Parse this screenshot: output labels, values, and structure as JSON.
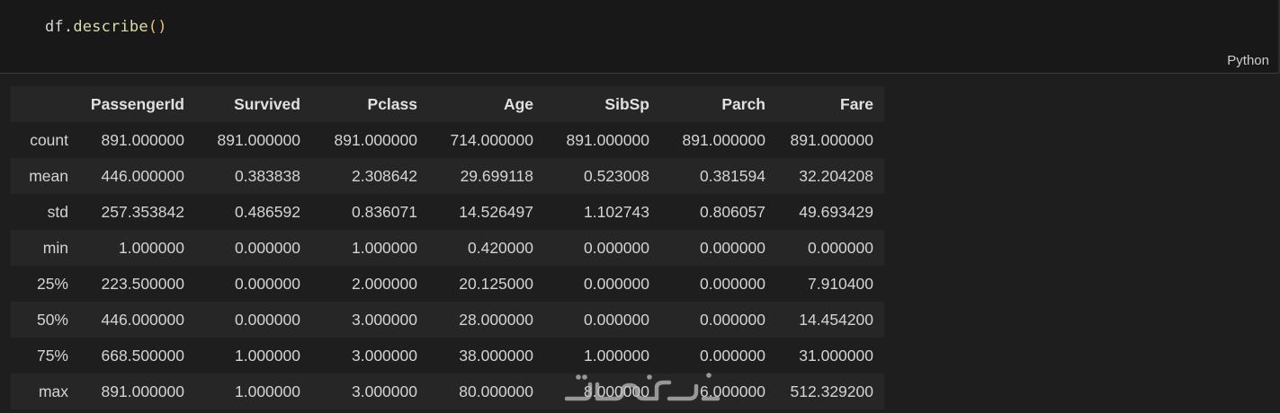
{
  "cell": {
    "code": {
      "object": "df",
      "dot": ".",
      "method": "describe",
      "parens": "()"
    },
    "language": "Python"
  },
  "table": {
    "columns": [
      "PassengerId",
      "Survived",
      "Pclass",
      "Age",
      "SibSp",
      "Parch",
      "Fare"
    ],
    "rows": [
      {
        "label": "count",
        "values": [
          "891.000000",
          "891.000000",
          "891.000000",
          "714.000000",
          "891.000000",
          "891.000000",
          "891.000000"
        ]
      },
      {
        "label": "mean",
        "values": [
          "446.000000",
          "0.383838",
          "2.308642",
          "29.699118",
          "0.523008",
          "0.381594",
          "32.204208"
        ]
      },
      {
        "label": "std",
        "values": [
          "257.353842",
          "0.486592",
          "0.836071",
          "14.526497",
          "1.102743",
          "0.806057",
          "49.693429"
        ]
      },
      {
        "label": "min",
        "values": [
          "1.000000",
          "0.000000",
          "1.000000",
          "0.420000",
          "0.000000",
          "0.000000",
          "0.000000"
        ]
      },
      {
        "label": "25%",
        "values": [
          "223.500000",
          "0.000000",
          "2.000000",
          "20.125000",
          "0.000000",
          "0.000000",
          "7.910400"
        ]
      },
      {
        "label": "50%",
        "values": [
          "446.000000",
          "0.000000",
          "3.000000",
          "28.000000",
          "0.000000",
          "0.000000",
          "14.454200"
        ]
      },
      {
        "label": "75%",
        "values": [
          "668.500000",
          "1.000000",
          "3.000000",
          "38.000000",
          "1.000000",
          "0.000000",
          "31.000000"
        ]
      },
      {
        "label": "max",
        "values": [
          "891.000000",
          "1.000000",
          "3.000000",
          "80.000000",
          "8.000000",
          "6.000000",
          "512.329200"
        ]
      }
    ]
  },
  "watermark": {
    "icon": "watermark-logo",
    "text": "خمسات"
  },
  "colors": {
    "background": "#1e1e1e",
    "cell_background": "#181818",
    "band_row": "#262626",
    "text": "#d4d4d4",
    "function": "#dcdcaa",
    "paren": "#e5c07b"
  }
}
